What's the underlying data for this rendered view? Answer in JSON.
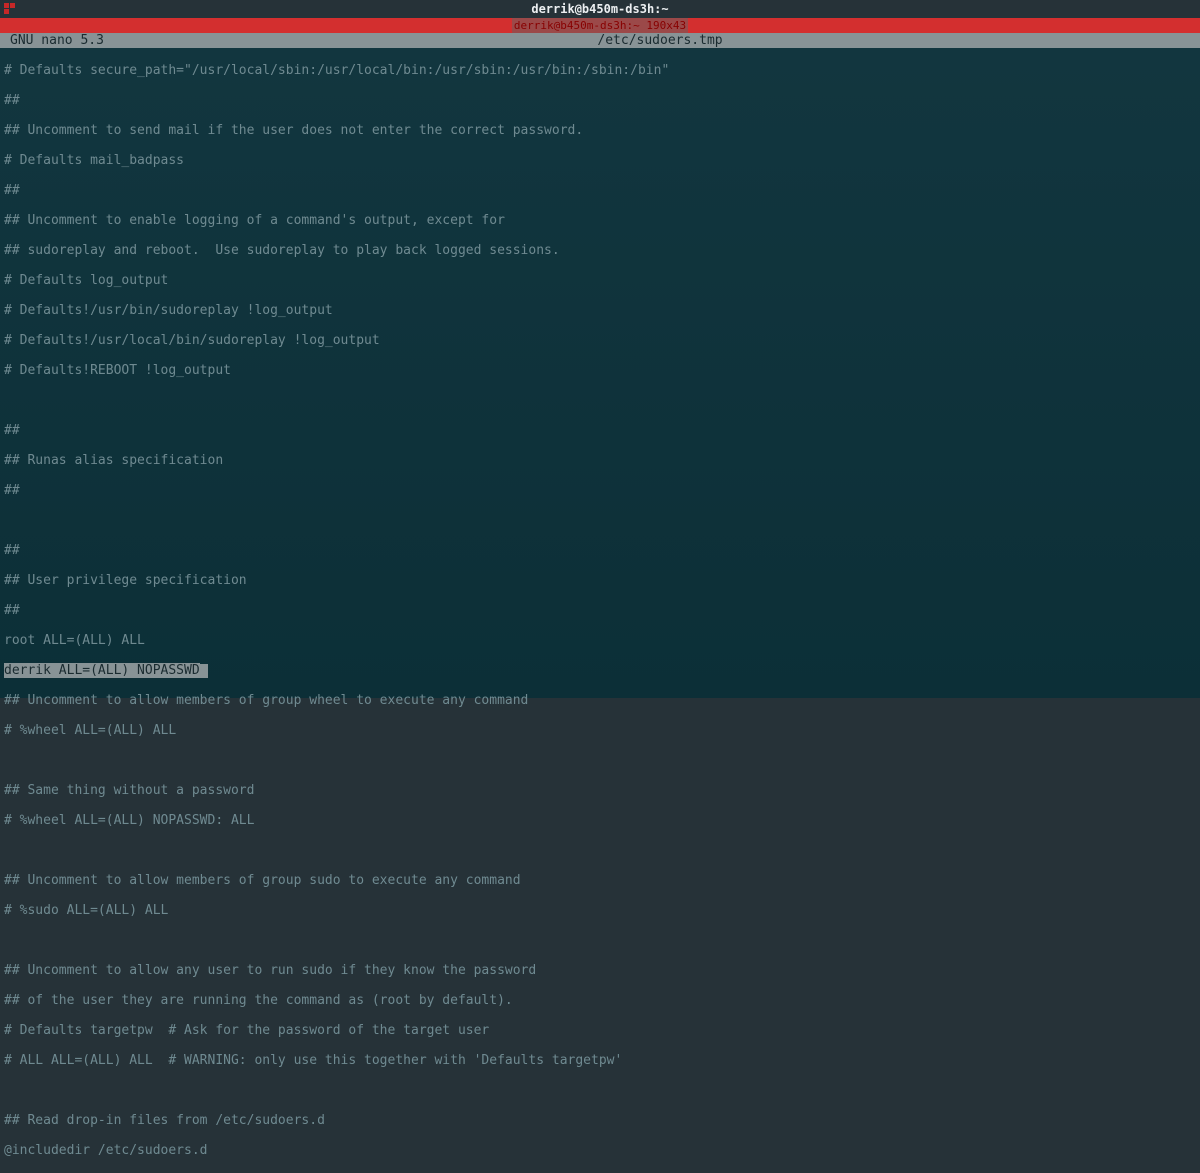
{
  "titlebar": {
    "title": "derrik@b450m-ds3h:~"
  },
  "redbar": {
    "text": "derrik@b450m-ds3h:~ 190x43"
  },
  "nanobar": {
    "app": "  GNU nano 5.3",
    "file": "/etc/sudoers.tmp"
  },
  "lines": {
    "l0": "# Defaults secure_path=\"/usr/local/sbin:/usr/local/bin:/usr/sbin:/usr/bin:/sbin:/bin\"",
    "l1": "##",
    "l2": "## Uncomment to send mail if the user does not enter the correct password.",
    "l3": "# Defaults mail_badpass",
    "l4": "##",
    "l5": "## Uncomment to enable logging of a command's output, except for",
    "l6": "## sudoreplay and reboot.  Use sudoreplay to play back logged sessions.",
    "l7": "# Defaults log_output",
    "l8": "# Defaults!/usr/bin/sudoreplay !log_output",
    "l9": "# Defaults!/usr/local/bin/sudoreplay !log_output",
    "l10": "# Defaults!REBOOT !log_output",
    "l11": "",
    "l12": "##",
    "l13": "## Runas alias specification",
    "l14": "##",
    "l15": "",
    "l16": "##",
    "l17": "## User privilege specification",
    "l18": "##",
    "l19": "root ALL=(ALL) ALL",
    "l20": "derrik ALL=(ALL) NOPASSWD",
    "l21": "## Uncomment to allow members of group wheel to execute any command",
    "l22": "# %wheel ALL=(ALL) ALL",
    "l23": "",
    "l24": "## Same thing without a password",
    "l25": "# %wheel ALL=(ALL) NOPASSWD: ALL",
    "l26": "",
    "l27": "## Uncomment to allow members of group sudo to execute any command",
    "l28": "# %sudo ALL=(ALL) ALL",
    "l29": "",
    "l30": "## Uncomment to allow any user to run sudo if they know the password",
    "l31": "## of the user they are running the command as (root by default).",
    "l32": "# Defaults targetpw  # Ask for the password of the target user",
    "l33": "# ALL ALL=(ALL) ALL  # WARNING: only use this together with 'Defaults targetpw'",
    "l34": "",
    "l35": "## Read drop-in files from /etc/sudoers.d",
    "l36": "@includedir /etc/sudoers.d"
  }
}
